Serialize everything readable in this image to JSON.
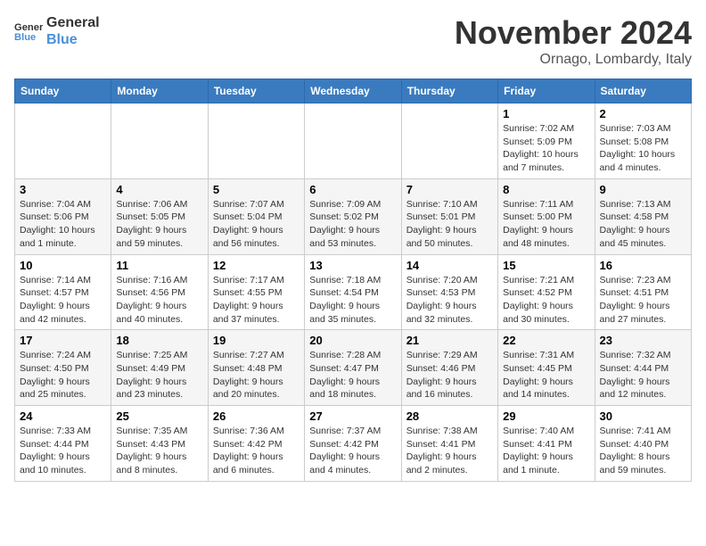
{
  "logo": {
    "line1": "General",
    "line2": "Blue"
  },
  "header": {
    "month": "November 2024",
    "location": "Ornago, Lombardy, Italy"
  },
  "weekdays": [
    "Sunday",
    "Monday",
    "Tuesday",
    "Wednesday",
    "Thursday",
    "Friday",
    "Saturday"
  ],
  "weeks": [
    [
      {
        "day": "",
        "info": ""
      },
      {
        "day": "",
        "info": ""
      },
      {
        "day": "",
        "info": ""
      },
      {
        "day": "",
        "info": ""
      },
      {
        "day": "",
        "info": ""
      },
      {
        "day": "1",
        "info": "Sunrise: 7:02 AM\nSunset: 5:09 PM\nDaylight: 10 hours and 7 minutes."
      },
      {
        "day": "2",
        "info": "Sunrise: 7:03 AM\nSunset: 5:08 PM\nDaylight: 10 hours and 4 minutes."
      }
    ],
    [
      {
        "day": "3",
        "info": "Sunrise: 7:04 AM\nSunset: 5:06 PM\nDaylight: 10 hours and 1 minute."
      },
      {
        "day": "4",
        "info": "Sunrise: 7:06 AM\nSunset: 5:05 PM\nDaylight: 9 hours and 59 minutes."
      },
      {
        "day": "5",
        "info": "Sunrise: 7:07 AM\nSunset: 5:04 PM\nDaylight: 9 hours and 56 minutes."
      },
      {
        "day": "6",
        "info": "Sunrise: 7:09 AM\nSunset: 5:02 PM\nDaylight: 9 hours and 53 minutes."
      },
      {
        "day": "7",
        "info": "Sunrise: 7:10 AM\nSunset: 5:01 PM\nDaylight: 9 hours and 50 minutes."
      },
      {
        "day": "8",
        "info": "Sunrise: 7:11 AM\nSunset: 5:00 PM\nDaylight: 9 hours and 48 minutes."
      },
      {
        "day": "9",
        "info": "Sunrise: 7:13 AM\nSunset: 4:58 PM\nDaylight: 9 hours and 45 minutes."
      }
    ],
    [
      {
        "day": "10",
        "info": "Sunrise: 7:14 AM\nSunset: 4:57 PM\nDaylight: 9 hours and 42 minutes."
      },
      {
        "day": "11",
        "info": "Sunrise: 7:16 AM\nSunset: 4:56 PM\nDaylight: 9 hours and 40 minutes."
      },
      {
        "day": "12",
        "info": "Sunrise: 7:17 AM\nSunset: 4:55 PM\nDaylight: 9 hours and 37 minutes."
      },
      {
        "day": "13",
        "info": "Sunrise: 7:18 AM\nSunset: 4:54 PM\nDaylight: 9 hours and 35 minutes."
      },
      {
        "day": "14",
        "info": "Sunrise: 7:20 AM\nSunset: 4:53 PM\nDaylight: 9 hours and 32 minutes."
      },
      {
        "day": "15",
        "info": "Sunrise: 7:21 AM\nSunset: 4:52 PM\nDaylight: 9 hours and 30 minutes."
      },
      {
        "day": "16",
        "info": "Sunrise: 7:23 AM\nSunset: 4:51 PM\nDaylight: 9 hours and 27 minutes."
      }
    ],
    [
      {
        "day": "17",
        "info": "Sunrise: 7:24 AM\nSunset: 4:50 PM\nDaylight: 9 hours and 25 minutes."
      },
      {
        "day": "18",
        "info": "Sunrise: 7:25 AM\nSunset: 4:49 PM\nDaylight: 9 hours and 23 minutes."
      },
      {
        "day": "19",
        "info": "Sunrise: 7:27 AM\nSunset: 4:48 PM\nDaylight: 9 hours and 20 minutes."
      },
      {
        "day": "20",
        "info": "Sunrise: 7:28 AM\nSunset: 4:47 PM\nDaylight: 9 hours and 18 minutes."
      },
      {
        "day": "21",
        "info": "Sunrise: 7:29 AM\nSunset: 4:46 PM\nDaylight: 9 hours and 16 minutes."
      },
      {
        "day": "22",
        "info": "Sunrise: 7:31 AM\nSunset: 4:45 PM\nDaylight: 9 hours and 14 minutes."
      },
      {
        "day": "23",
        "info": "Sunrise: 7:32 AM\nSunset: 4:44 PM\nDaylight: 9 hours and 12 minutes."
      }
    ],
    [
      {
        "day": "24",
        "info": "Sunrise: 7:33 AM\nSunset: 4:44 PM\nDaylight: 9 hours and 10 minutes."
      },
      {
        "day": "25",
        "info": "Sunrise: 7:35 AM\nSunset: 4:43 PM\nDaylight: 9 hours and 8 minutes."
      },
      {
        "day": "26",
        "info": "Sunrise: 7:36 AM\nSunset: 4:42 PM\nDaylight: 9 hours and 6 minutes."
      },
      {
        "day": "27",
        "info": "Sunrise: 7:37 AM\nSunset: 4:42 PM\nDaylight: 9 hours and 4 minutes."
      },
      {
        "day": "28",
        "info": "Sunrise: 7:38 AM\nSunset: 4:41 PM\nDaylight: 9 hours and 2 minutes."
      },
      {
        "day": "29",
        "info": "Sunrise: 7:40 AM\nSunset: 4:41 PM\nDaylight: 9 hours and 1 minute."
      },
      {
        "day": "30",
        "info": "Sunrise: 7:41 AM\nSunset: 4:40 PM\nDaylight: 8 hours and 59 minutes."
      }
    ]
  ]
}
